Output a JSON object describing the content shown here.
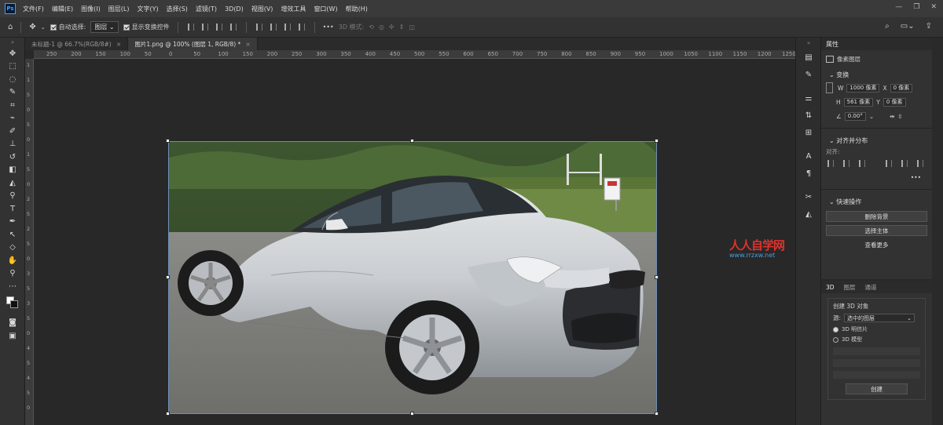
{
  "app": {
    "logo": "Ps"
  },
  "menu": [
    "文件(F)",
    "编辑(E)",
    "图像(I)",
    "图层(L)",
    "文字(Y)",
    "选择(S)",
    "滤镜(T)",
    "3D(D)",
    "视图(V)",
    "增效工具",
    "窗口(W)",
    "帮助(H)"
  ],
  "options": {
    "auto_select_label": "自动选择:",
    "auto_select_value": "图层",
    "show_transform_label": "显示变换控件",
    "more": "•••",
    "mode_3d": "3D 模式:"
  },
  "tabs": [
    {
      "label": "未标题-1 @ 66.7%(RGB/8#)",
      "close": "×"
    },
    {
      "label": "图片1.png @ 100% (图层 1, RGB/8) *",
      "close": "×"
    }
  ],
  "ruler": {
    "top": [
      "250",
      "200",
      "150",
      "100",
      "50",
      "0",
      "50",
      "100",
      "150",
      "200",
      "250",
      "300",
      "350",
      "400",
      "450",
      "500",
      "550",
      "600",
      "650",
      "700",
      "750",
      "800",
      "850",
      "900",
      "950",
      "1000",
      "1050",
      "1100",
      "1150",
      "1200",
      "1250"
    ],
    "left": [
      "1",
      "1",
      "5",
      "0",
      "5",
      "0",
      "1",
      "5",
      "0",
      "2",
      "5",
      "2",
      "5",
      "0",
      "3",
      "5",
      "3",
      "5",
      "0",
      "4",
      "5",
      "4",
      "5",
      "0"
    ]
  },
  "properties": {
    "tab": "属性",
    "pixel_layer": "像素图层",
    "transform": {
      "title": "变换",
      "w_label": "W",
      "w_value": "1000 像素",
      "x_label": "X",
      "x_value": "0 像素",
      "h_label": "H",
      "h_value": "561 像素",
      "y_label": "Y",
      "y_value": "0 像素",
      "angle": "0.00°"
    },
    "align": {
      "title": "对齐并分布",
      "label": "对齐:",
      "more": "•••"
    },
    "quick_actions": {
      "title": "快速操作",
      "remove_bg": "删除背景",
      "select_subject": "选择主体",
      "view_more": "查看更多"
    }
  },
  "panel3d": {
    "tabs": [
      "3D",
      "图层",
      "通道"
    ],
    "create_title": "创建 3D 对象",
    "source_label": "源:",
    "source_value": "选中的图层",
    "options": [
      {
        "label": "3D 明信片",
        "selected": true
      },
      {
        "label": "3D 模型",
        "selected": false
      }
    ],
    "create_button": "创建"
  },
  "watermark": {
    "brand": "人人自学网",
    "url": "www.rrzxw.net"
  },
  "colors": {
    "accent": "#31a8ff",
    "watermark_red": "#e0322c"
  }
}
